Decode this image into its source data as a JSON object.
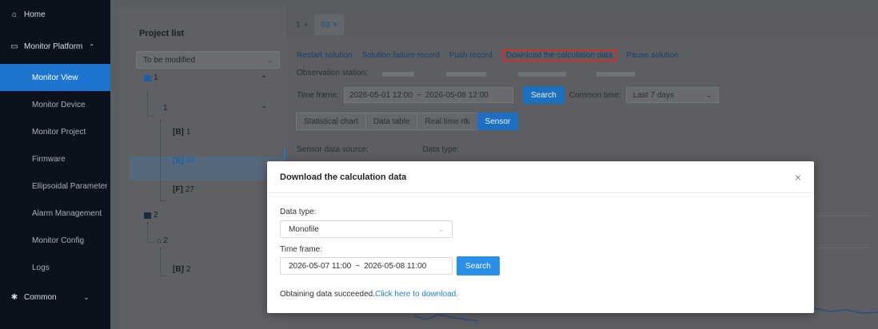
{
  "sidebar": {
    "home": "Home",
    "monitor_platform": "Monitor Platform",
    "items": [
      {
        "label": "Monitor View",
        "active": true
      },
      {
        "label": "Monitor Device"
      },
      {
        "label": "Monitor Project"
      },
      {
        "label": "Firmware"
      },
      {
        "label": "Ellipsoidal Parameter"
      },
      {
        "label": "Alarm Management"
      },
      {
        "label": "Monitor Config"
      },
      {
        "label": "Logs"
      }
    ],
    "common": "Common"
  },
  "project_panel": {
    "title": "Project list",
    "filter_value": "To be modified",
    "tree": [
      {
        "label": "1"
      },
      {
        "label": "1"
      },
      {
        "tag": "[B]",
        "label": "1"
      },
      {
        "tag": "[B]",
        "label": "03"
      },
      {
        "tag": "[F]",
        "label": "27"
      },
      {
        "label": "2"
      },
      {
        "label": "2"
      },
      {
        "tag": "[B]",
        "label": "2"
      }
    ]
  },
  "tabs": [
    {
      "label": "1",
      "close": "×"
    },
    {
      "label": "03",
      "close": "×"
    }
  ],
  "actions": [
    "Restart solution",
    "Solution failure record",
    "Push record",
    "Download the calculation data",
    "Pause solution"
  ],
  "observation_label": "Observation station:",
  "timeframe": {
    "label": "Time frame:",
    "start": "2026-05-01 12:00",
    "sep": "~",
    "end": "2026-05-08 12:00",
    "search": "Search",
    "common_time_label": "Common time:",
    "common_time_value": "Last 7 days"
  },
  "segments": [
    "Statistical chart",
    "Data table",
    "Real time rtk",
    "Sensor"
  ],
  "sensor_labels": {
    "source": "Sensor data source:",
    "type": "Data type:"
  },
  "modal": {
    "title": "Download the calculation data",
    "close": "×",
    "data_type_label": "Data type:",
    "data_type_value": "Monofile",
    "time_frame_label": "Time frame:",
    "range_start": "2026-05-07 11:00",
    "range_sep": "~",
    "range_end": "2026-05-08 11:00",
    "search": "Search",
    "status_text": "Obtaining data succeeded.",
    "status_link": "Click here to download."
  }
}
